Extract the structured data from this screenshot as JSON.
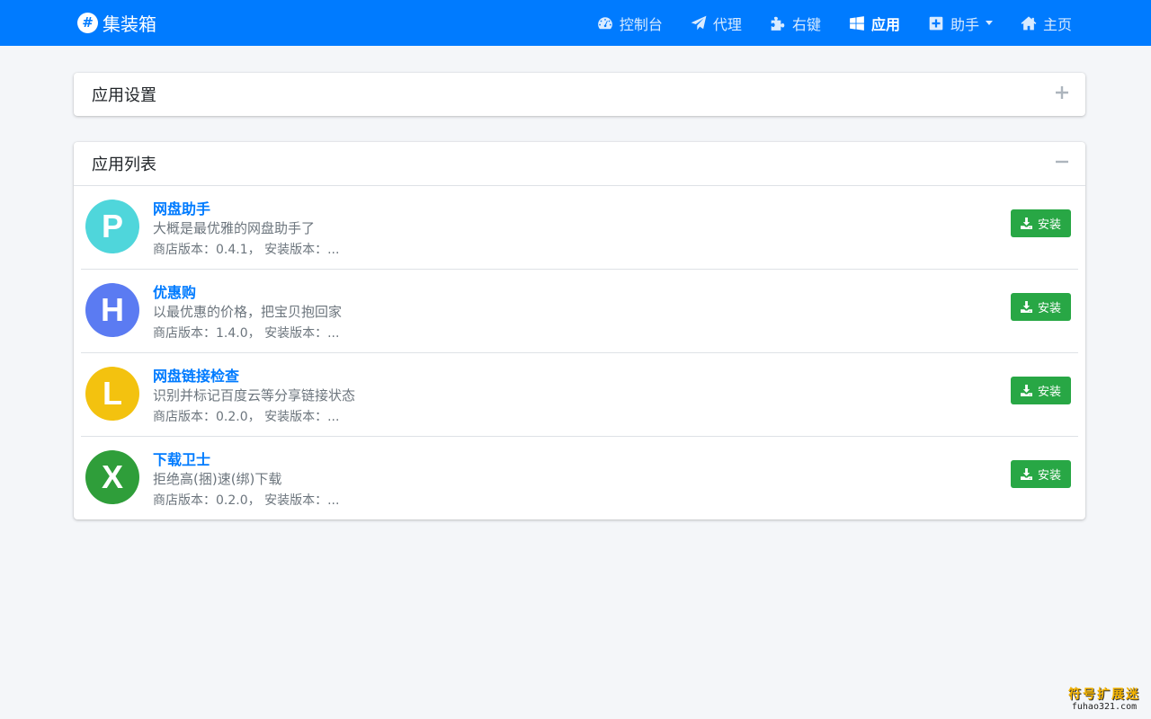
{
  "navbar": {
    "brand_logo": "#",
    "brand_text": "集装箱",
    "items": [
      {
        "label": "控制台",
        "icon": "dashboard-icon"
      },
      {
        "label": "代理",
        "icon": "paper-plane-icon"
      },
      {
        "label": "右键",
        "icon": "puzzle-icon"
      },
      {
        "label": "应用",
        "icon": "windows-icon",
        "active": true
      },
      {
        "label": "助手",
        "icon": "plus-square-icon",
        "dropdown": true
      },
      {
        "label": "主页",
        "icon": "home-icon"
      }
    ],
    "bg_color": "#007bff"
  },
  "settings_card": {
    "title": "应用设置",
    "tool_icon": "plus-icon"
  },
  "list_card": {
    "title": "应用列表",
    "tool_icon": "minus-icon",
    "apps": [
      {
        "letter": "P",
        "color": "#4fd6db",
        "name": "网盘助手",
        "desc": "大概是最优雅的网盘助手了",
        "version": "商店版本：0.4.1， 安装版本：...",
        "button": "安装"
      },
      {
        "letter": "H",
        "color": "#5b7bf2",
        "name": "优惠购",
        "desc": "以最优惠的价格，把宝贝抱回家",
        "version": "商店版本：1.4.0， 安装版本：...",
        "button": "安装"
      },
      {
        "letter": "L",
        "color": "#f3c20f",
        "name": "网盘链接检查",
        "desc": "识别并标记百度云等分享链接状态",
        "version": "商店版本：0.2.0， 安装版本：...",
        "button": "安装"
      },
      {
        "letter": "X",
        "color": "#2f9e3a",
        "name": "下载卫士",
        "desc": "拒绝高(捆)速(绑)下载",
        "version": "商店版本：0.2.0， 安装版本：...",
        "button": "安装"
      }
    ]
  },
  "watermark": {
    "line1": "符号扩展迷",
    "line2": "fuhao321.com"
  },
  "colors": {
    "primary": "#007bff",
    "success": "#28a745",
    "background": "#f4f6f9"
  }
}
